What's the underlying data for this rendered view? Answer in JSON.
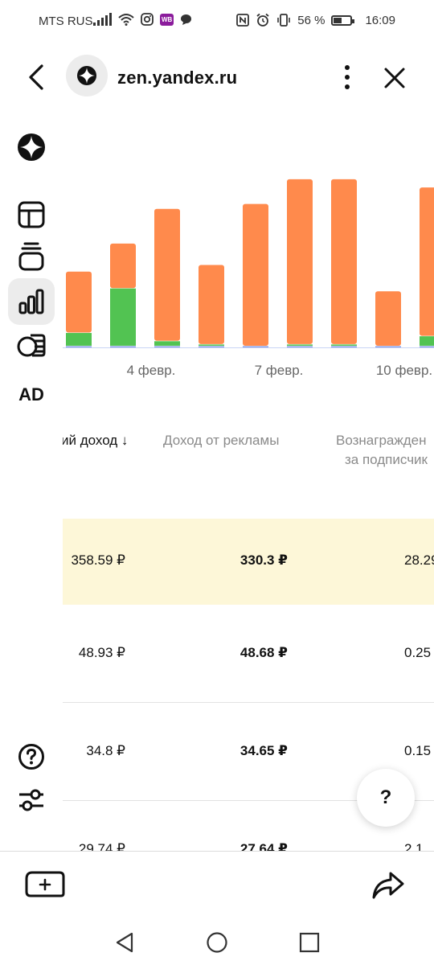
{
  "status_bar": {
    "carrier": "MTS RUS",
    "wb_badge": "WB",
    "battery_percent": "56 %",
    "time": "16:09"
  },
  "browser": {
    "url": "zen.yandex.ru"
  },
  "rail": {
    "ad_label": "AD"
  },
  "chart_data": {
    "type": "bar",
    "stacked": true,
    "x_tick_labels": [
      "4 февр.",
      "7 февр.",
      "10 февр."
    ],
    "bars": [
      {
        "orange": 0.37,
        "green": 0.08,
        "blue": 0.01
      },
      {
        "orange": 0.27,
        "green": 0.35,
        "blue": 0.01
      },
      {
        "orange": 0.8,
        "green": 0.03,
        "blue": 0.01
      },
      {
        "orange": 0.48,
        "green": 0.01,
        "blue": 0.01
      },
      {
        "orange": 0.86,
        "green": 0.0,
        "blue": 0.01
      },
      {
        "orange": 1.0,
        "green": 0.01,
        "blue": 0.01
      },
      {
        "orange": 1.0,
        "green": 0.01,
        "blue": 0.01
      },
      {
        "orange": 0.33,
        "green": 0.0,
        "blue": 0.01
      },
      {
        "orange": 0.9,
        "green": 0.06,
        "blue": 0.01
      }
    ],
    "colors": {
      "orange": "#ff8a4c",
      "green": "#52c352",
      "blue": "#8aa0e6",
      "axis": "#c9d4f5"
    }
  },
  "table": {
    "columns": {
      "total": "ий доход ↓",
      "ads": "Доход от рекламы",
      "subs_line1": "Вознагражден",
      "subs_line2": "за подписчик"
    },
    "rows": [
      {
        "total": "358.59 ₽",
        "ads": "330.3 ₽",
        "subs": "28.29"
      },
      {
        "total": "48.93 ₽",
        "ads": "48.68 ₽",
        "subs": "0.25"
      },
      {
        "total": "34.8 ₽",
        "ads": "34.65 ₽",
        "subs": "0.15"
      },
      {
        "total": "29.74 ₽",
        "ads": "27.64 ₽",
        "subs": "2.1"
      }
    ]
  },
  "help_fab": {
    "label": "?"
  },
  "colors": {
    "highlight_row": "#fdf7d8",
    "accent_orange": "#ff8a4c",
    "accent_green": "#52c352"
  }
}
